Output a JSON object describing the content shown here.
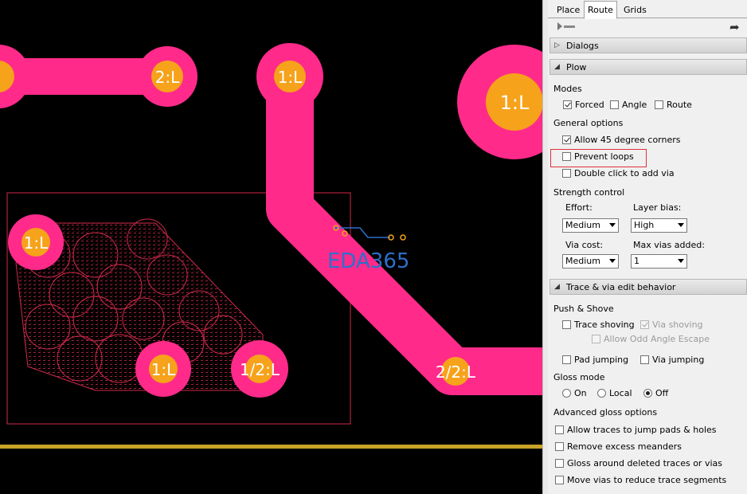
{
  "canvas": {
    "pads": [
      {
        "label": "2:L"
      },
      {
        "label": "1:L"
      },
      {
        "label": "1:L"
      },
      {
        "label": "1:L"
      },
      {
        "label": "1:L"
      },
      {
        "label": "1/2:L"
      },
      {
        "label": "2/2:L"
      }
    ],
    "watermark": "EDA365",
    "colors": {
      "trace": "#ff2a8a",
      "pad": "#f7a21b",
      "board_edge": "#c9a227",
      "selection": "#d02a4a",
      "watermark": "#2c6fcb"
    }
  },
  "panel": {
    "tabs": [
      {
        "label": "Place",
        "active": false
      },
      {
        "label": "Route",
        "active": true
      },
      {
        "label": "Grids",
        "active": false
      }
    ],
    "toolbar_icons": [
      "route-play-icon",
      "exit-icon"
    ],
    "sections": {
      "dialogs": "Dialogs",
      "plow": "Plow",
      "trace_via": "Trace & via edit behavior"
    },
    "modes": {
      "heading": "Modes",
      "forced": {
        "label": "Forced",
        "checked": true
      },
      "angle": {
        "label": "Angle",
        "checked": false
      },
      "route": {
        "label": "Route",
        "checked": false
      }
    },
    "general": {
      "heading": "General options",
      "allow45": {
        "label": "Allow 45 degree corners",
        "checked": true
      },
      "prevent_loops": {
        "label": "Prevent loops",
        "checked": false
      },
      "double_click": {
        "label": "Double click to add via",
        "checked": false
      }
    },
    "strength": {
      "heading": "Strength control",
      "effort_label": "Effort:",
      "effort_value": "Medium",
      "layer_bias_label": "Layer bias:",
      "layer_bias_value": "High",
      "via_cost_label": "Via cost:",
      "via_cost_value": "Medium",
      "max_vias_label": "Max vias added:",
      "max_vias_value": "1"
    },
    "push_shove": {
      "heading": "Push & Shove",
      "trace_shoving": {
        "label": "Trace shoving",
        "checked": false
      },
      "via_shoving": {
        "label": "Via shoving",
        "checked": true,
        "disabled": true
      },
      "odd_angle": {
        "label": "Allow Odd Angle Escape",
        "checked": false,
        "disabled": true
      },
      "pad_jumping": {
        "label": "Pad jumping",
        "checked": false
      },
      "via_jumping": {
        "label": "Via jumping",
        "checked": false
      }
    },
    "gloss": {
      "heading": "Gloss mode",
      "on": "On",
      "local": "Local",
      "off": "Off",
      "selected": "Off"
    },
    "advanced": {
      "heading": "Advanced gloss options",
      "items": [
        {
          "label": "Allow traces to jump pads & holes",
          "checked": false
        },
        {
          "label": "Remove excess meanders",
          "checked": false
        },
        {
          "label": "Gloss around deleted traces or vias",
          "checked": false
        },
        {
          "label": "Move vias to reduce trace segments",
          "checked": false
        }
      ]
    }
  }
}
